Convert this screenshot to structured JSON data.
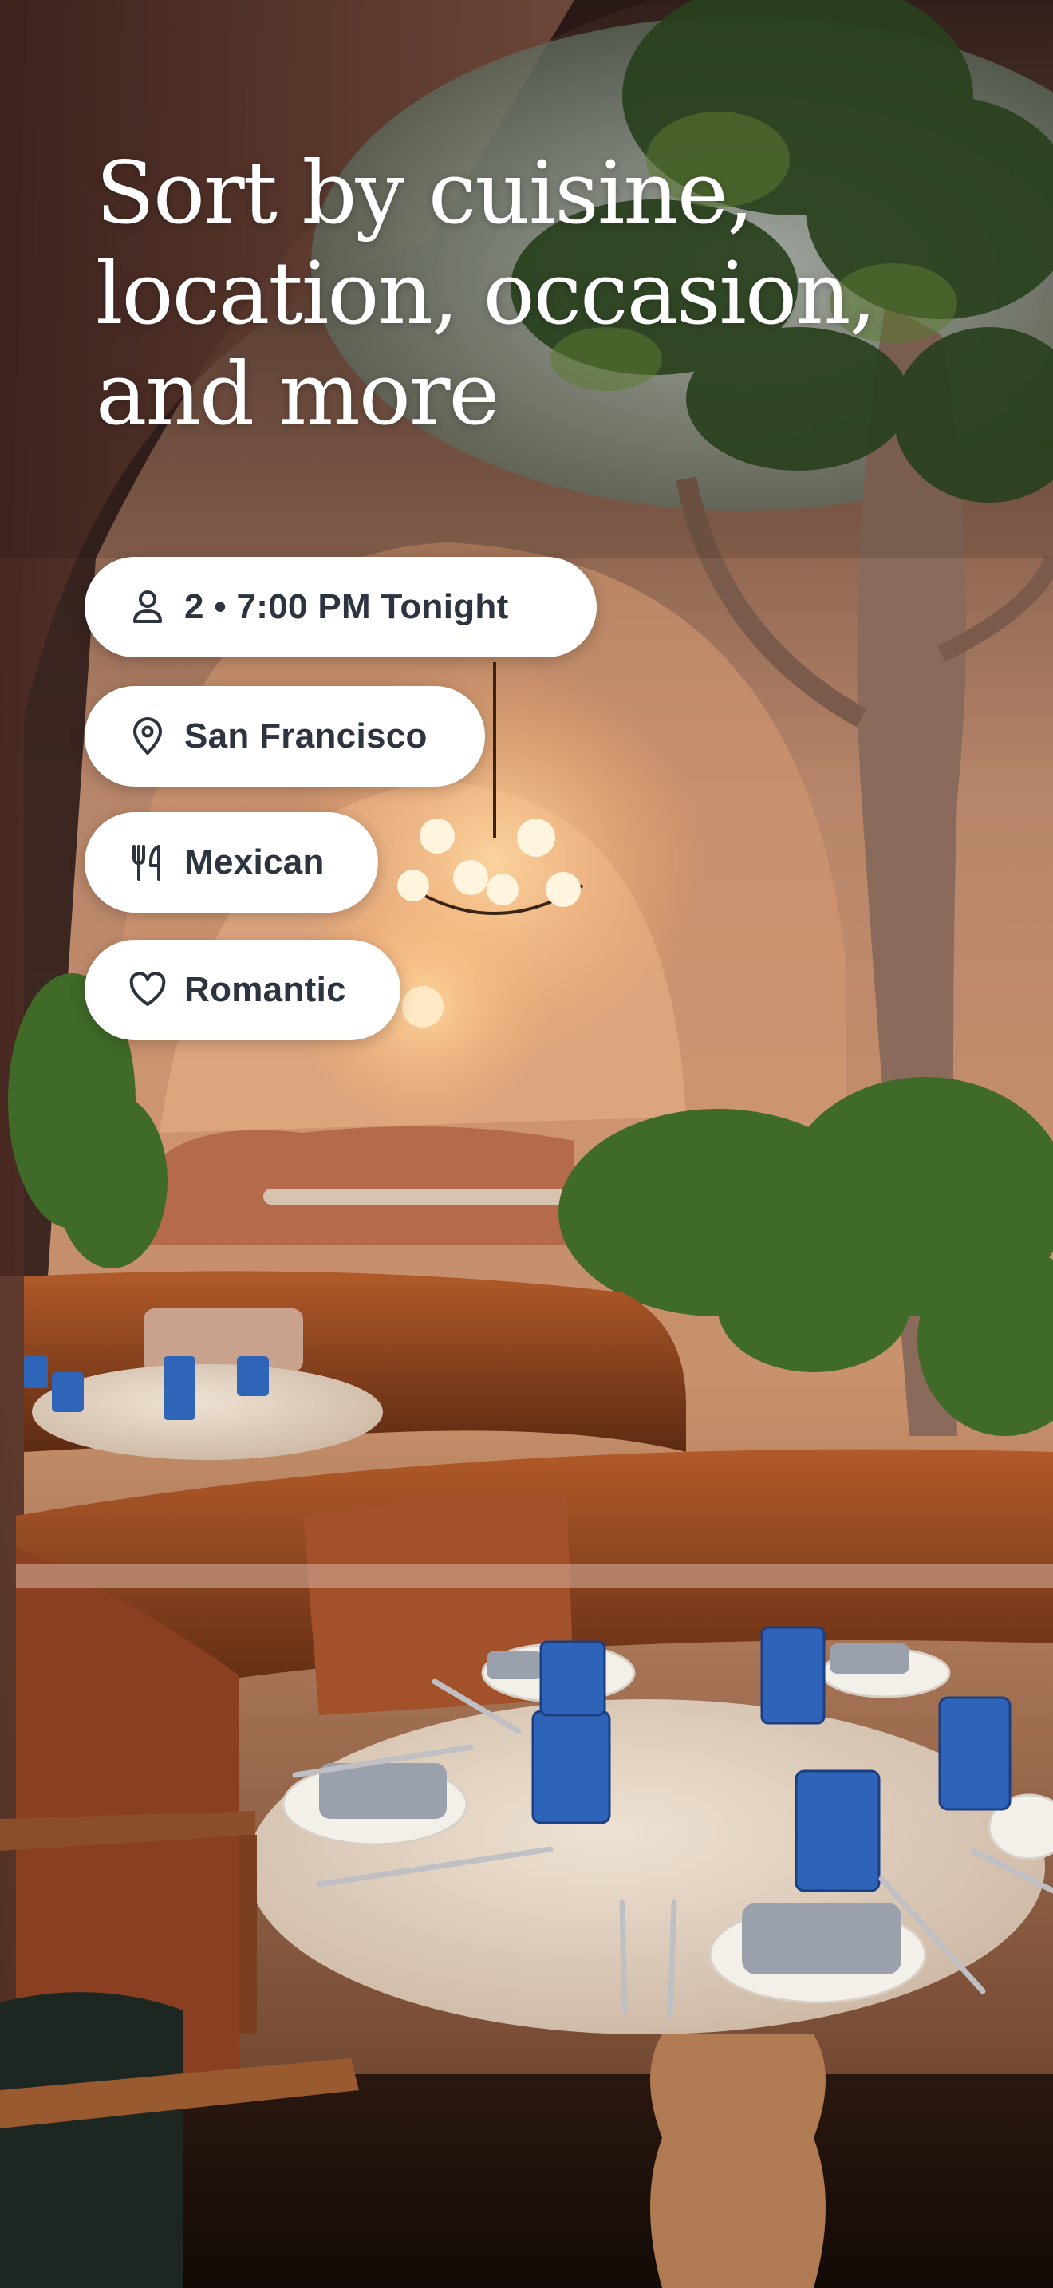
{
  "headline": {
    "lines": [
      "Sort by cuisine,",
      "location, occasion,",
      "and more"
    ]
  },
  "filters": [
    {
      "icon": "person-icon",
      "label": "2 • 7:00 PM Tonight"
    },
    {
      "icon": "location-pin-icon",
      "label": "San Francisco"
    },
    {
      "icon": "fork-knife-icon",
      "label": "Mexican"
    },
    {
      "icon": "heart-icon",
      "label": "Romantic"
    }
  ],
  "colors": {
    "chip_background": "#ffffff",
    "chip_text": "#2d333f",
    "headline_text": "#ffffff"
  }
}
